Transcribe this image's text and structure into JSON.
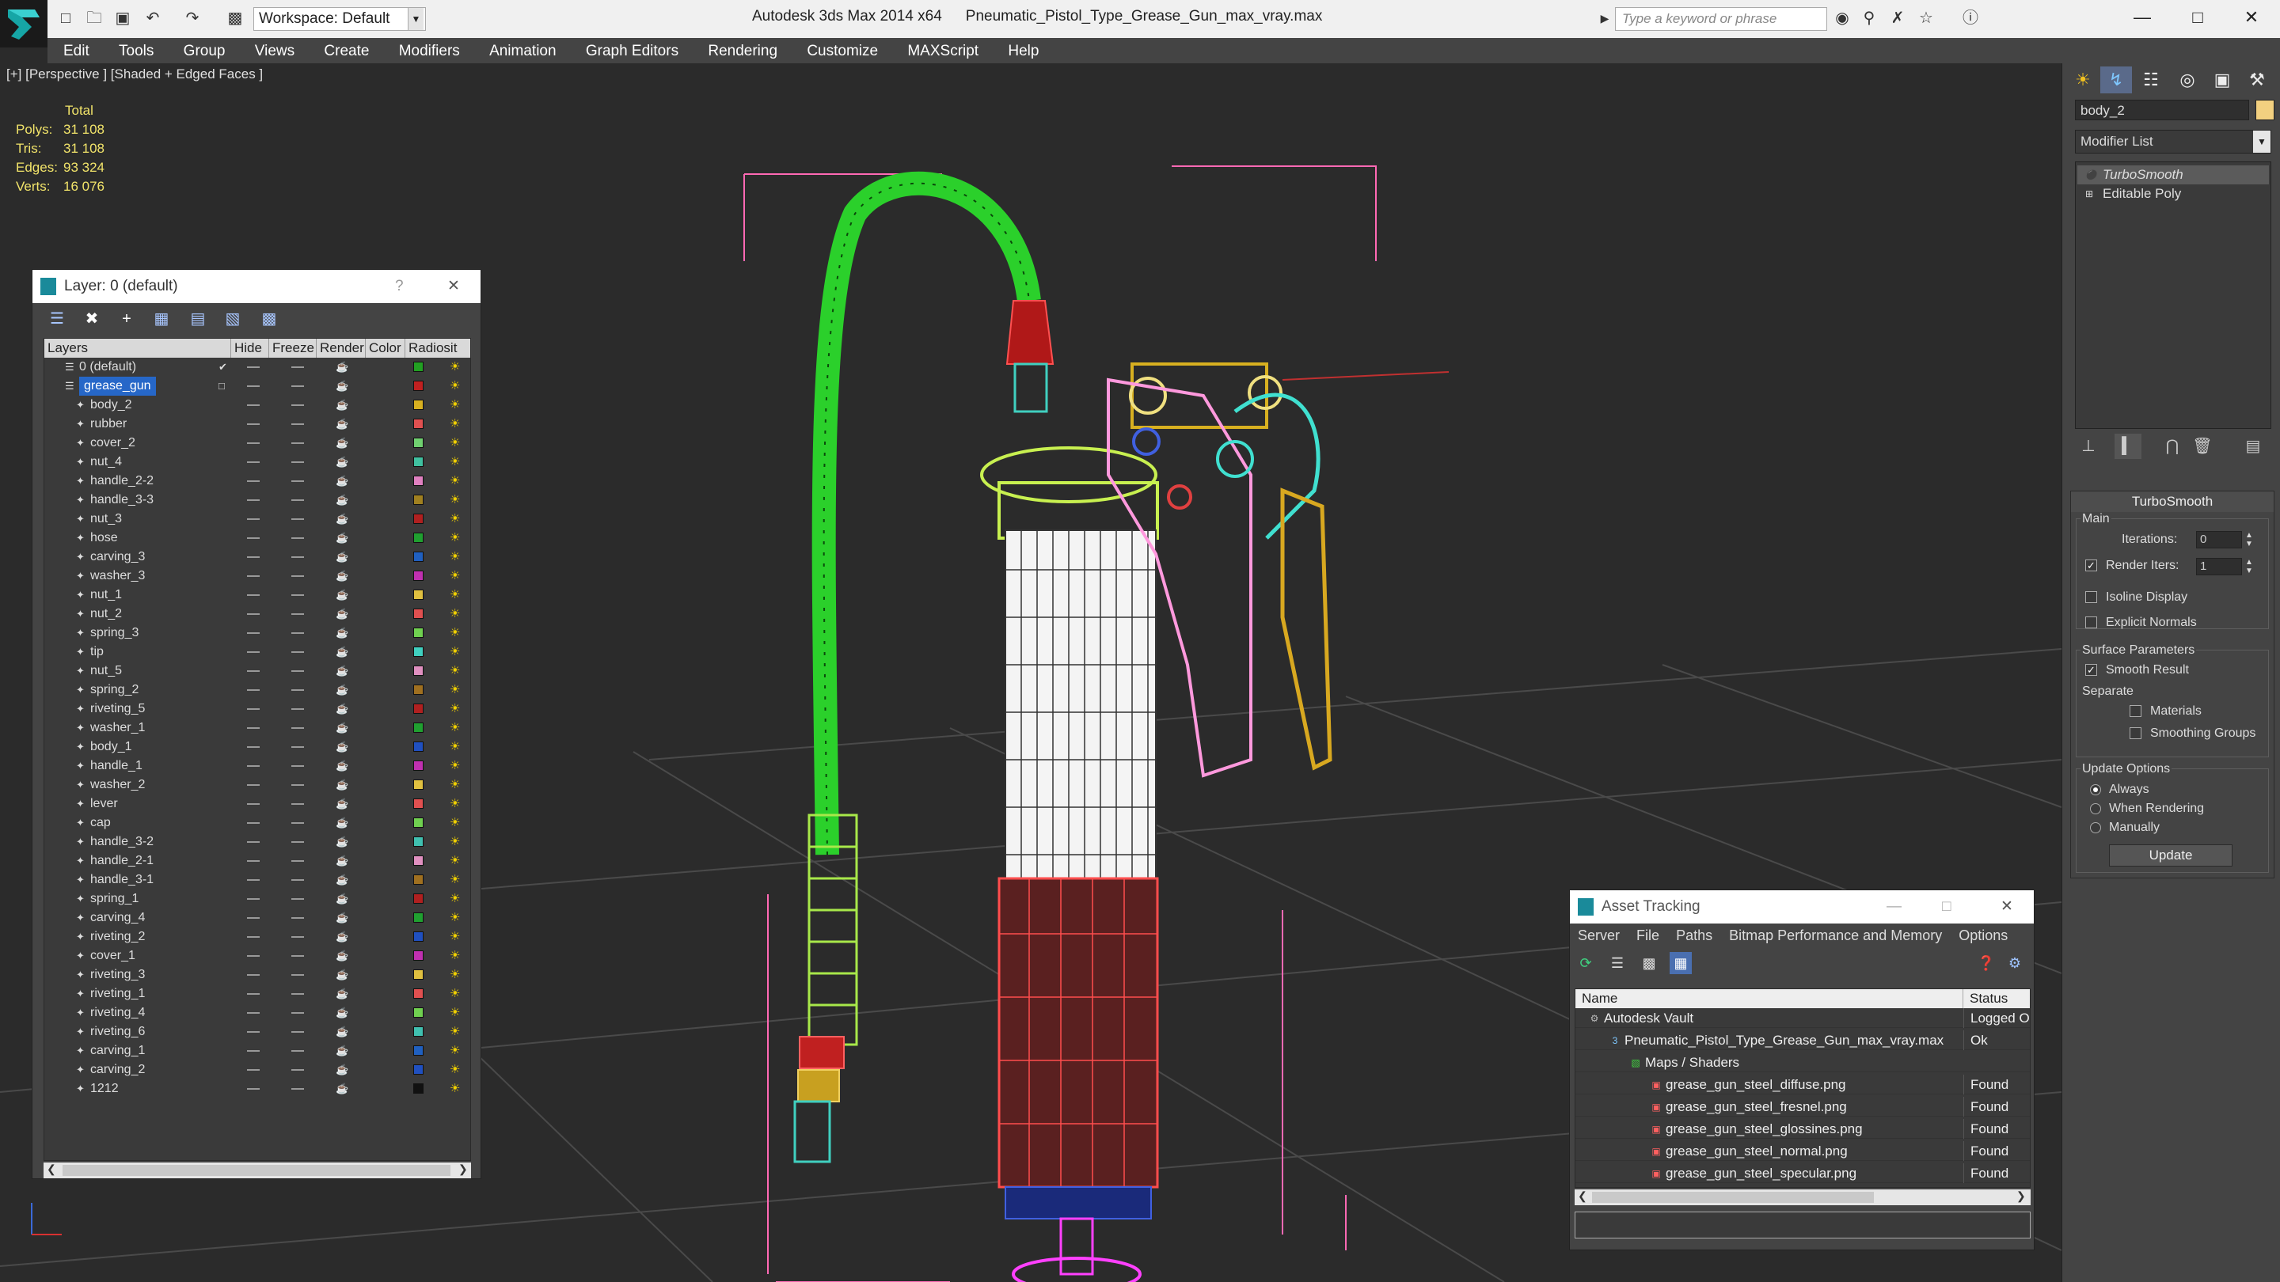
{
  "app": {
    "name": "Autodesk 3ds Max  2014 x64",
    "file": "Pneumatic_Pistol_Type_Grease_Gun_max_vray.max",
    "workspace": "Workspace: Default",
    "search_placeholder": "Type a keyword or phrase"
  },
  "menu": [
    "Edit",
    "Tools",
    "Group",
    "Views",
    "Create",
    "Modifiers",
    "Animation",
    "Graph Editors",
    "Rendering",
    "Customize",
    "MAXScript",
    "Help"
  ],
  "viewport": {
    "label": "[+] [Perspective ] [Shaded + Edged Faces ]",
    "stats": {
      "header": "Total",
      "rows": [
        {
          "label": "Polys:",
          "value": "31 108"
        },
        {
          "label": "Tris:",
          "value": "31 108"
        },
        {
          "label": "Edges:",
          "value": "93 324"
        },
        {
          "label": "Verts:",
          "value": "16 076"
        }
      ]
    }
  },
  "layer_panel": {
    "title": "Layer: 0 (default)",
    "help": "?",
    "columns": [
      "Layers",
      "Hide",
      "Freeze",
      "Render",
      "Color",
      "Radiosit"
    ],
    "layers": [
      {
        "name": "0 (default)",
        "color": "#22a022",
        "level": 0,
        "check": true
      },
      {
        "name": "grease_gun",
        "color": "#c02020",
        "level": 0,
        "selected": true
      },
      {
        "name": "body_2",
        "color": "#d8b020",
        "level": 1
      },
      {
        "name": "rubber",
        "color": "#e05050",
        "level": 1
      },
      {
        "name": "cover_2",
        "color": "#70d070",
        "level": 1
      },
      {
        "name": "nut_4",
        "color": "#40c0a0",
        "level": 1
      },
      {
        "name": "handle_2-2",
        "color": "#e080c0",
        "level": 1
      },
      {
        "name": "handle_3-3",
        "color": "#a08020",
        "level": 1
      },
      {
        "name": "nut_3",
        "color": "#b02020",
        "level": 1
      },
      {
        "name": "hose",
        "color": "#20a030",
        "level": 1
      },
      {
        "name": "carving_3",
        "color": "#2060c0",
        "level": 1
      },
      {
        "name": "washer_3",
        "color": "#c030b0",
        "level": 1
      },
      {
        "name": "nut_1",
        "color": "#e0c040",
        "level": 1
      },
      {
        "name": "nut_2",
        "color": "#e05050",
        "level": 1
      },
      {
        "name": "spring_3",
        "color": "#70d050",
        "level": 1
      },
      {
        "name": "tip",
        "color": "#40d0c0",
        "level": 1
      },
      {
        "name": "nut_5",
        "color": "#e090c0",
        "level": 1
      },
      {
        "name": "spring_2",
        "color": "#a07020",
        "level": 1
      },
      {
        "name": "riveting_5",
        "color": "#b02020",
        "level": 1
      },
      {
        "name": "washer_1",
        "color": "#20a030",
        "level": 1
      },
      {
        "name": "body_1",
        "color": "#2050c0",
        "level": 1
      },
      {
        "name": "handle_1",
        "color": "#c030b0",
        "level": 1
      },
      {
        "name": "washer_2",
        "color": "#e0c040",
        "level": 1
      },
      {
        "name": "lever",
        "color": "#e05050",
        "level": 1
      },
      {
        "name": "cap",
        "color": "#70d050",
        "level": 1
      },
      {
        "name": "handle_3-2",
        "color": "#40c0b0",
        "level": 1
      },
      {
        "name": "handle_2-1",
        "color": "#e090c0",
        "level": 1
      },
      {
        "name": "handle_3-1",
        "color": "#a07020",
        "level": 1
      },
      {
        "name": "spring_1",
        "color": "#b02020",
        "level": 1
      },
      {
        "name": "carving_4",
        "color": "#20a030",
        "level": 1
      },
      {
        "name": "riveting_2",
        "color": "#2050c0",
        "level": 1
      },
      {
        "name": "cover_1",
        "color": "#c030b0",
        "level": 1
      },
      {
        "name": "riveting_3",
        "color": "#e0c040",
        "level": 1
      },
      {
        "name": "riveting_1",
        "color": "#e05050",
        "level": 1
      },
      {
        "name": "riveting_4",
        "color": "#70d050",
        "level": 1
      },
      {
        "name": "riveting_6",
        "color": "#40c0b0",
        "level": 1
      },
      {
        "name": "carving_1",
        "color": "#2060c0",
        "level": 1
      },
      {
        "name": "carving_2",
        "color": "#2050c0",
        "level": 1
      },
      {
        "name": "1212",
        "color": "#111111",
        "level": 1
      }
    ]
  },
  "command_panel": {
    "object_name": "body_2",
    "modifier_list": "Modifier List",
    "stack": [
      "TurboSmooth",
      "Editable Poly"
    ],
    "rollout": {
      "title": "TurboSmooth",
      "main": "Main",
      "iterations_label": "Iterations:",
      "iterations": "0",
      "render_iters_label": "Render Iters:",
      "render_iters": "1",
      "isoline": "Isoline Display",
      "explicit": "Explicit Normals",
      "surface": "Surface Parameters",
      "smooth_result": "Smooth Result",
      "separate": "Separate",
      "materials": "Materials",
      "smoothing_groups": "Smoothing Groups",
      "update_options": "Update Options",
      "always": "Always",
      "when_rendering": "When Rendering",
      "manually": "Manually",
      "update": "Update"
    }
  },
  "asset_tracking": {
    "title": "Asset Tracking",
    "menu": [
      "Server",
      "File",
      "Paths",
      "Bitmap Performance and Memory",
      "Options"
    ],
    "columns": [
      "Name",
      "Status"
    ],
    "rows": [
      {
        "name": "Autodesk Vault",
        "status": "Logged Out",
        "indent": 0,
        "icon": "vault-icon"
      },
      {
        "name": "Pneumatic_Pistol_Type_Grease_Gun_max_vray.max",
        "status": "Ok",
        "indent": 1,
        "icon": "max-file-icon"
      },
      {
        "name": "Maps / Shaders",
        "status": "",
        "indent": 2,
        "icon": "maps-icon"
      },
      {
        "name": "grease_gun_steel_diffuse.png",
        "status": "Found",
        "indent": 3,
        "icon": "png-icon"
      },
      {
        "name": "grease_gun_steel_fresnel.png",
        "status": "Found",
        "indent": 3,
        "icon": "png-icon"
      },
      {
        "name": "grease_gun_steel_glossines.png",
        "status": "Found",
        "indent": 3,
        "icon": "png-icon"
      },
      {
        "name": "grease_gun_steel_normal.png",
        "status": "Found",
        "indent": 3,
        "icon": "png-icon"
      },
      {
        "name": "grease_gun_steel_specular.png",
        "status": "Found",
        "indent": 3,
        "icon": "png-icon"
      }
    ]
  }
}
